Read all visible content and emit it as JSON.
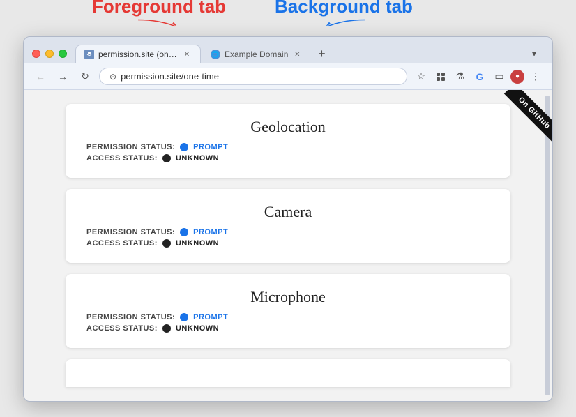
{
  "labels": {
    "foreground_tab": "Foreground tab",
    "background_tab": "Background tab"
  },
  "browser": {
    "tabs": [
      {
        "id": "tab-permission",
        "title": "permission.site (one-time)",
        "favicon": "🔗",
        "active": true
      },
      {
        "id": "tab-example",
        "title": "Example Domain",
        "favicon": "🌐",
        "active": false
      }
    ],
    "address_bar": {
      "url": "permission.site/one-time",
      "icon": "⊙"
    },
    "nav": {
      "back": "←",
      "forward": "→",
      "refresh": "↻"
    }
  },
  "github_ribbon": "On GitHub",
  "cards": [
    {
      "id": "geolocation",
      "title": "Geolocation",
      "permission_label": "PERMISSION STATUS:",
      "permission_dot_color": "blue",
      "permission_value": "PROMPT",
      "access_label": "ACCESS STATUS:",
      "access_dot_color": "black",
      "access_value": "UNKNOWN"
    },
    {
      "id": "camera",
      "title": "Camera",
      "permission_label": "PERMISSION STATUS:",
      "permission_dot_color": "blue",
      "permission_value": "PROMPT",
      "access_label": "ACCESS STATUS:",
      "access_dot_color": "black",
      "access_value": "UNKNOWN"
    },
    {
      "id": "microphone",
      "title": "Microphone",
      "permission_label": "PERMISSION STATUS:",
      "permission_dot_color": "blue",
      "permission_value": "PROMPT",
      "access_label": "ACCESS STATUS:",
      "access_dot_color": "black",
      "access_value": "UNKNOWN"
    }
  ],
  "colors": {
    "foreground_tab_label": "#e53935",
    "background_tab_label": "#1a73e8",
    "dot_blue": "#1a73e8",
    "dot_black": "#222222"
  }
}
